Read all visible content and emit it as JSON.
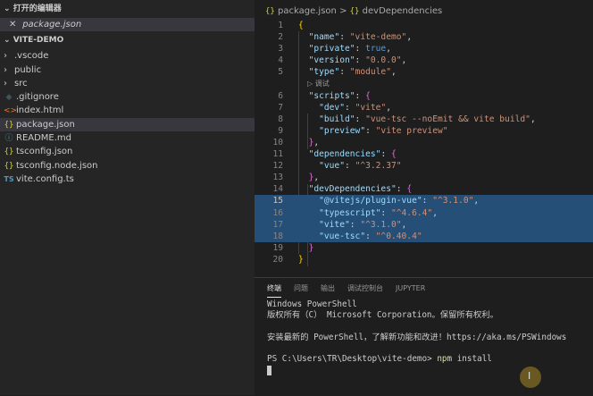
{
  "explorer": {
    "open_editors_title": "打开的编辑器",
    "open_editor_file": "package.json",
    "close_glyph": "✕",
    "project_title": "VITE-DEMO",
    "items": [
      {
        "name": ".vscode",
        "kind": "folder"
      },
      {
        "name": "public",
        "kind": "folder"
      },
      {
        "name": "src",
        "kind": "folder"
      },
      {
        "name": ".gitignore",
        "kind": "git"
      },
      {
        "name": "index.html",
        "kind": "html"
      },
      {
        "name": "package.json",
        "kind": "json",
        "selected": true
      },
      {
        "name": "README.md",
        "kind": "info"
      },
      {
        "name": "tsconfig.json",
        "kind": "json"
      },
      {
        "name": "tsconfig.node.json",
        "kind": "json"
      },
      {
        "name": "vite.config.ts",
        "kind": "ts"
      }
    ]
  },
  "icons": {
    "folder": "chevron-right-icon",
    "json": "json-file-icon",
    "html": "html-file-icon",
    "info": "info-file-icon",
    "ts": "ts-file-icon",
    "git": "git-file-icon"
  },
  "breadcrumb": {
    "file": "package.json",
    "separator": ">",
    "section": "devDependencies"
  },
  "code": {
    "codelens": "调试",
    "active_line": 15
  },
  "panel": {
    "tabs": [
      "终端",
      "问题",
      "输出",
      "调试控制台",
      "JUPYTER"
    ],
    "active_tab": "终端",
    "terminal_lines": [
      "Windows PowerShell",
      "版权所有（C） Microsoft Corporation。保留所有权利。",
      "",
      "安装最新的 PowerShell，了解新功能和改进！https://aka.ms/PSWindows",
      ""
    ],
    "prompt": "PS C:\\Users\\TR\\Desktop\\vite-demo> ",
    "command": "npm",
    "command_args": " install"
  },
  "colors": {
    "selection": "#264f78",
    "accent": "#007acc",
    "cursor_highlight": "#c8a028"
  }
}
